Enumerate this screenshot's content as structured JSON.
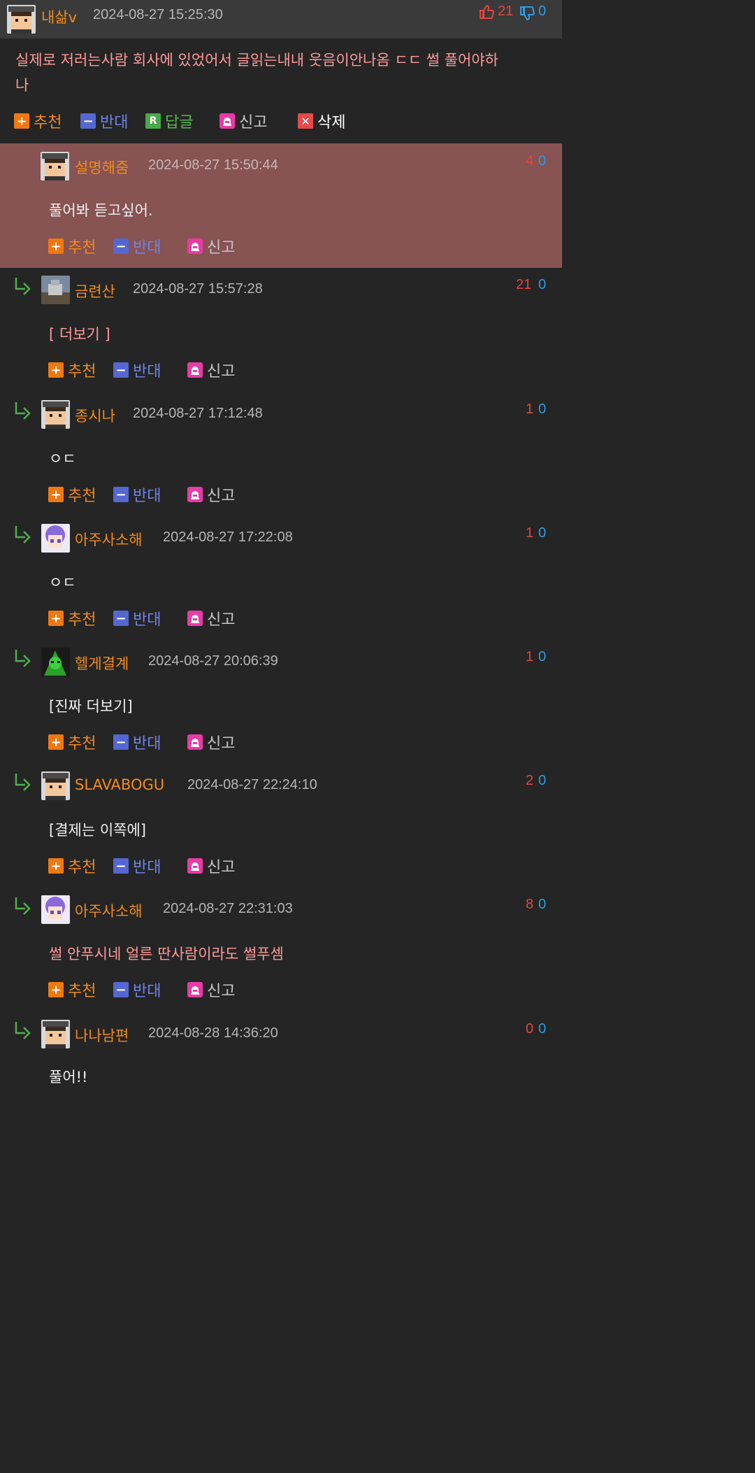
{
  "main_comment": {
    "nick": "내삶v",
    "date": "2024-08-27 15:25:30",
    "up": "21",
    "down": "0",
    "text_line1": "실제로 저러는사람 회사에 있었어서 글읽는내내 웃음이안나옴 ㄷㄷ 썰 풀어야하",
    "text_line2": "나",
    "actions": {
      "recommend": "추천",
      "oppose": "반대",
      "reply": "답글",
      "report": "신고",
      "delete": "삭제"
    }
  },
  "actions": {
    "recommend": "추천",
    "oppose": "반대",
    "report": "신고"
  },
  "replies": [
    {
      "nick": "설명해줌",
      "date": "2024-08-27 15:50:44",
      "up": "4",
      "down": "0",
      "text": "풀어봐 듣고싶어.",
      "highlight": true
    },
    {
      "nick": "금련산",
      "date": "2024-08-27 15:57:28",
      "up": "21",
      "down": "0",
      "text": "[ 더보기 ]"
    },
    {
      "nick": "종시나",
      "date": "2024-08-27 17:12:48",
      "up": "1",
      "down": "0",
      "text": "ㅇㄷ"
    },
    {
      "nick": "아주사소해",
      "date": "2024-08-27 17:22:08",
      "up": "1",
      "down": "0",
      "text": "ㅇㄷ"
    },
    {
      "nick": "헬게결계",
      "date": "2024-08-27 20:06:39",
      "up": "1",
      "down": "0",
      "text": "[진짜 더보기]"
    },
    {
      "nick": "SLAVABOGU",
      "date": "2024-08-27 22:24:10",
      "up": "2",
      "down": "0",
      "text": "[결제는 이쪽에]"
    },
    {
      "nick": "아주사소해",
      "date": "2024-08-27 22:31:03",
      "up": "8",
      "down": "0",
      "text": "썰 안푸시네 얼른 딴사람이라도 썰푸셈"
    },
    {
      "nick": "나나남편",
      "date": "2024-08-28 14:36:20",
      "up": "0",
      "down": "0",
      "text": "풀어!!"
    }
  ],
  "colors": {
    "nick": "#f28b1c",
    "up": "#e2473e",
    "down": "#2e9be3",
    "highlight_bg": "#875353"
  },
  "icons": [
    "thumbs-up-icon",
    "thumbs-down-icon",
    "plus-icon",
    "minus-icon",
    "reply-r-icon",
    "siren-icon",
    "close-x-icon",
    "reply-arrow-icon"
  ]
}
